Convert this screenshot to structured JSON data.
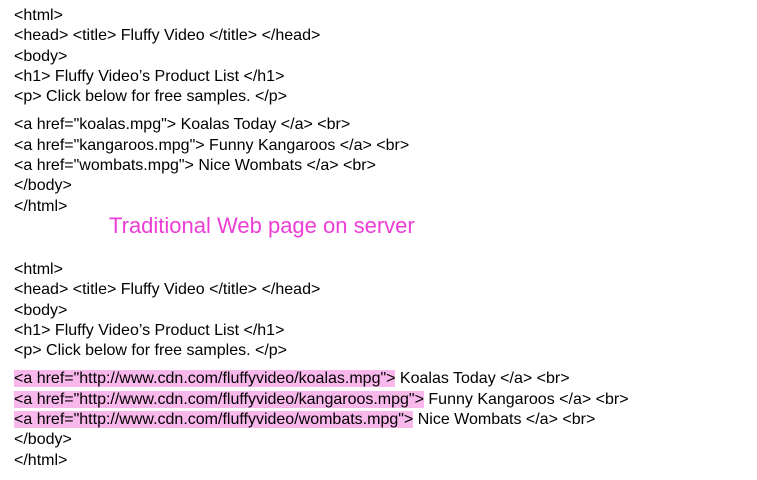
{
  "traditional": {
    "lines": [
      "<html>",
      "<head> <title> Fluffy Video </title> </head>",
      "<body>",
      "<h1> Fluffy Video’s Product List </h1>",
      "<p> Click below for free samples. </p>"
    ],
    "links": [
      "<a href=\"koalas.mpg\"> Koalas Today </a> <br>",
      "<a href=\"kangaroos.mpg\"> Funny Kangaroos </a> <br>",
      "<a href=\"wombats.mpg\"> Nice Wombats </a> <br>"
    ],
    "closing": [
      "</body>",
      "</html>"
    ]
  },
  "caption": "Traditional Web page on server",
  "cdn": {
    "lines": [
      "<html>",
      "<head> <title> Fluffy Video </title> </head>",
      "<body>",
      "<h1> Fluffy Video’s Product List </h1>",
      "<p> Click below for free samples. </p>"
    ],
    "links": [
      {
        "tag": "<a href=\"http://www.cdn.com/fluffyvideo/koalas.mpg\">",
        "rest": " Koalas Today </a> <br>"
      },
      {
        "tag": "<a href=\"http://www.cdn.com/fluffyvideo/kangaroos.mpg\">",
        "rest": " Funny Kangaroos </a> <br>"
      },
      {
        "tag": "<a href=\"http://www.cdn.com/fluffyvideo/wombats.mpg\">",
        "rest": " Nice Wombats </a> <br>"
      }
    ],
    "closing": [
      "</body>",
      "</html>"
    ]
  },
  "colors": {
    "caption": "#ec3dd6",
    "highlight": "#f9b8ec",
    "text": "#000000",
    "background": "#ffffff"
  }
}
